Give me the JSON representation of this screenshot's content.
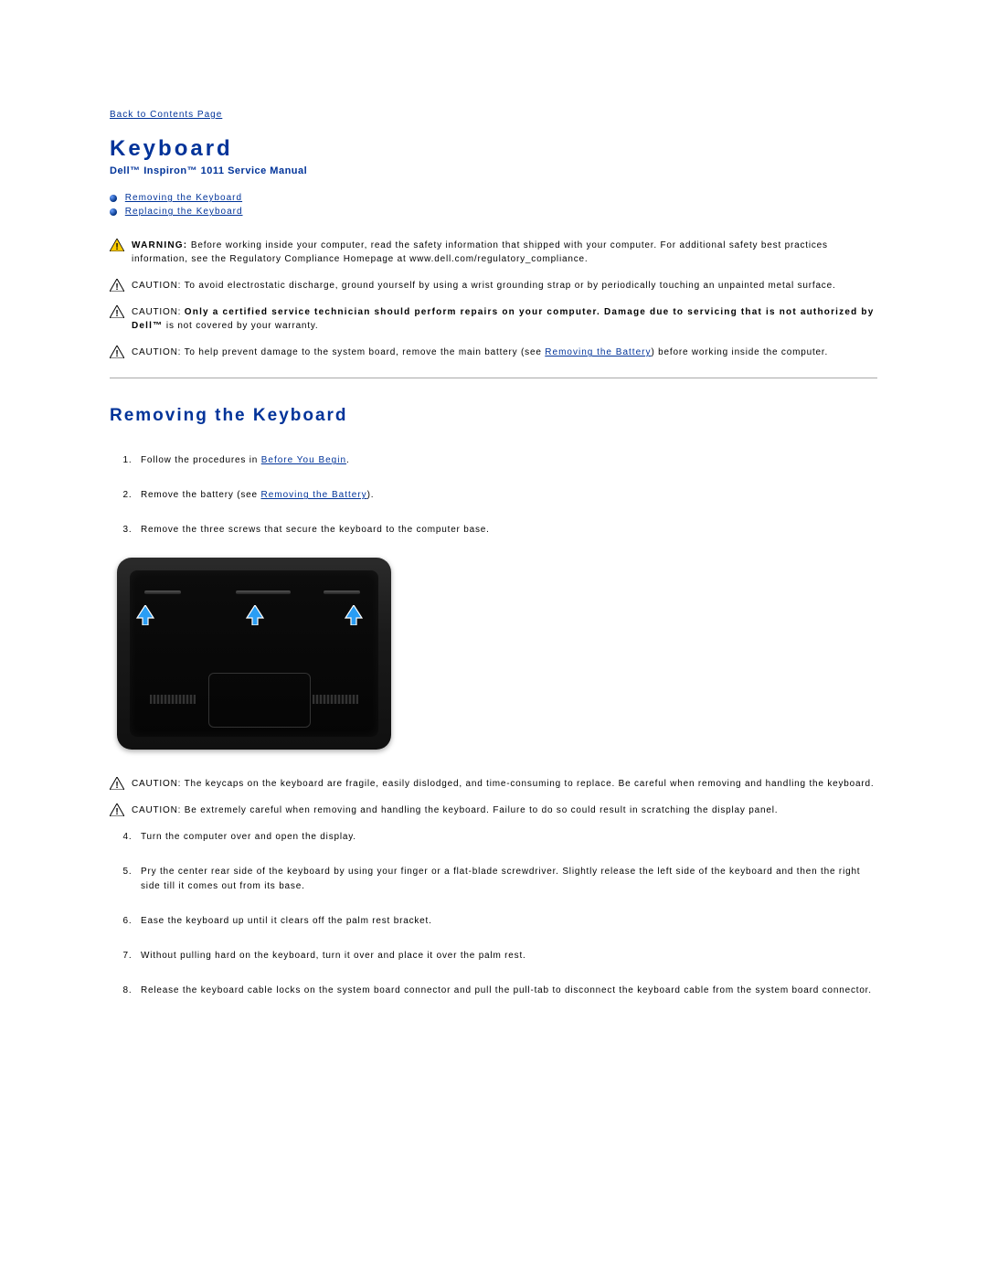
{
  "nav": {
    "back_label": "Back to Contents Page"
  },
  "header": {
    "title": "Keyboard",
    "subtitle": "Dell™ Inspiron™ 1011 Service Manual"
  },
  "toc": {
    "items": [
      {
        "label": "Removing the Keyboard"
      },
      {
        "label": "Replacing the Keyboard"
      }
    ]
  },
  "notices_top": {
    "warning": {
      "prefix": "WARNING:",
      "text": "Before working inside your computer, read the safety information that shipped with your computer. For additional safety best practices information, see the Regulatory Compliance Homepage at www.dell.com/regulatory_compliance."
    },
    "caution_esd": {
      "prefix": "CAUTION:",
      "text": "To avoid electrostatic discharge, ground yourself by using a wrist grounding strap or by periodically touching an unpainted metal surface."
    },
    "caution_tech": {
      "prefix": "CAUTION:",
      "text_bold": "Only a certified service technician should perform repairs on your computer. Damage due to servicing that is not authorized by Dell™",
      "text_tail": " is not covered by your warranty."
    },
    "caution_battery": {
      "prefix": "CAUTION:",
      "text_a": "To help prevent damage to the system board, remove the main battery (see ",
      "link": "Removing the Battery",
      "text_b": ") before working inside the computer."
    }
  },
  "section": {
    "title": "Removing the Keyboard"
  },
  "steps_a": {
    "s1_a": "Follow the procedures in ",
    "s1_link": "Before You Begin",
    "s1_b": ".",
    "s2_a": "Remove the battery (see ",
    "s2_link": "Removing the Battery",
    "s2_b": ").",
    "s3": "Remove the three screws that secure the keyboard to the computer base."
  },
  "notices_mid": {
    "caution_keycaps": {
      "prefix": "CAUTION:",
      "text": "The keycaps on the keyboard are fragile, easily dislodged, and time-consuming to replace. Be careful when removing and handling the keyboard."
    },
    "caution_scratch": {
      "prefix": "CAUTION:",
      "text": "Be extremely careful when removing and handling the keyboard. Failure to do so could result in scratching the display panel."
    }
  },
  "steps_b": {
    "s4": "Turn the computer over and open the display.",
    "s5": "Pry the center rear side of the keyboard by using your finger or a flat-blade screwdriver. Slightly release the left side of the keyboard and then the right side till it comes out from its base.",
    "s6": "Ease the keyboard up until it clears off the palm rest bracket.",
    "s7": "Without pulling hard on the keyboard, turn it over and place it over the palm rest.",
    "s8": "Release the keyboard cable locks on the system board connector and pull the pull-tab to disconnect the keyboard cable from the system board connector."
  }
}
